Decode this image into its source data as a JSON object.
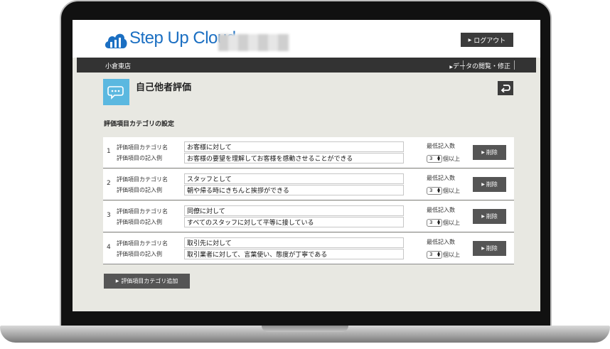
{
  "header": {
    "logo_text": "Step Up Cloud",
    "logout_label": "ログアウト"
  },
  "nav": {
    "store_name": "小倉東店",
    "data_link": "データの閲覧・修正"
  },
  "page": {
    "title": "自己他者評価",
    "section_title": "評価項目カテゴリの設定"
  },
  "labels": {
    "category_name": "評価項目カテゴリ名",
    "example": "評価項目の記入例",
    "min_count": "最低記入数",
    "unit": "個以上",
    "delete": "削除",
    "add_category": "評価項目カテゴリ追加"
  },
  "rows": [
    {
      "num": "1",
      "name": "お客様に対して",
      "example": "お客様の要望を理解してお客様を感動させることができる",
      "min": "3"
    },
    {
      "num": "2",
      "name": "スタッフとして",
      "example": "朝や帰る時にきちんと挨拶ができる",
      "min": "3"
    },
    {
      "num": "3",
      "name": "同僚に対して",
      "example": "すべてのスタッフに対して平等に接している",
      "min": "3"
    },
    {
      "num": "4",
      "name": "取引先に対して",
      "example": "取引業者に対して、言葉使い、態度が丁寧である",
      "min": "3"
    }
  ],
  "icons": {
    "logo": "cloud-logo-icon",
    "title": "speech-bubble-icon",
    "back": "return-arrow-icon"
  },
  "colors": {
    "brand": "#1b6fc2",
    "title_icon_bg": "#5bb8e0",
    "navbar": "#333333",
    "button": "#555555",
    "content_bg": "#e8e8e2"
  }
}
